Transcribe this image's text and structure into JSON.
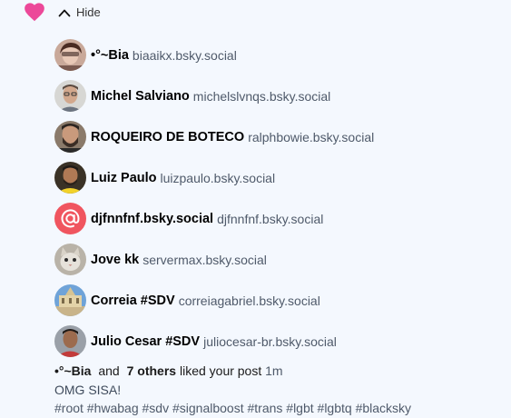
{
  "toggle": {
    "label": "Hide"
  },
  "users": [
    {
      "name": "•°~Bia",
      "handle": "biaaikx.bsky.social",
      "avatar": "photo-1"
    },
    {
      "name": "Michel Salviano",
      "handle": "michelslvnqs.bsky.social",
      "avatar": "photo-2"
    },
    {
      "name": "ROQUEIRO DE BOTECO",
      "handle": "ralphbowie.bsky.social",
      "avatar": "photo-3"
    },
    {
      "name": "Luiz Paulo",
      "handle": "luizpaulo.bsky.social",
      "avatar": "photo-4"
    },
    {
      "name": "djfnnfnf.bsky.social",
      "handle": "djfnnfnf.bsky.social",
      "avatar": "default-at"
    },
    {
      "name": "Jove kk",
      "handle": "servermax.bsky.social",
      "avatar": "photo-6"
    },
    {
      "name": "Correia #SDV",
      "handle": "correiagabriel.bsky.social",
      "avatar": "photo-7"
    },
    {
      "name": "Julio Cesar #SDV",
      "handle": "juliocesar-br.bsky.social",
      "avatar": "photo-8"
    }
  ],
  "summary": {
    "first_name": "•°~Bia",
    "and": "and",
    "others": "7 others",
    "action": "liked your post",
    "time": "1m"
  },
  "post": {
    "text": "OMG SISA!",
    "tags": "#root #hwabag #sdv #signalboost #trans #lgbt #lgbtq #blacksky"
  },
  "colors": {
    "heart": "#ec4899",
    "default_avatar": "#f0555f",
    "background": "#f4f8fe"
  }
}
